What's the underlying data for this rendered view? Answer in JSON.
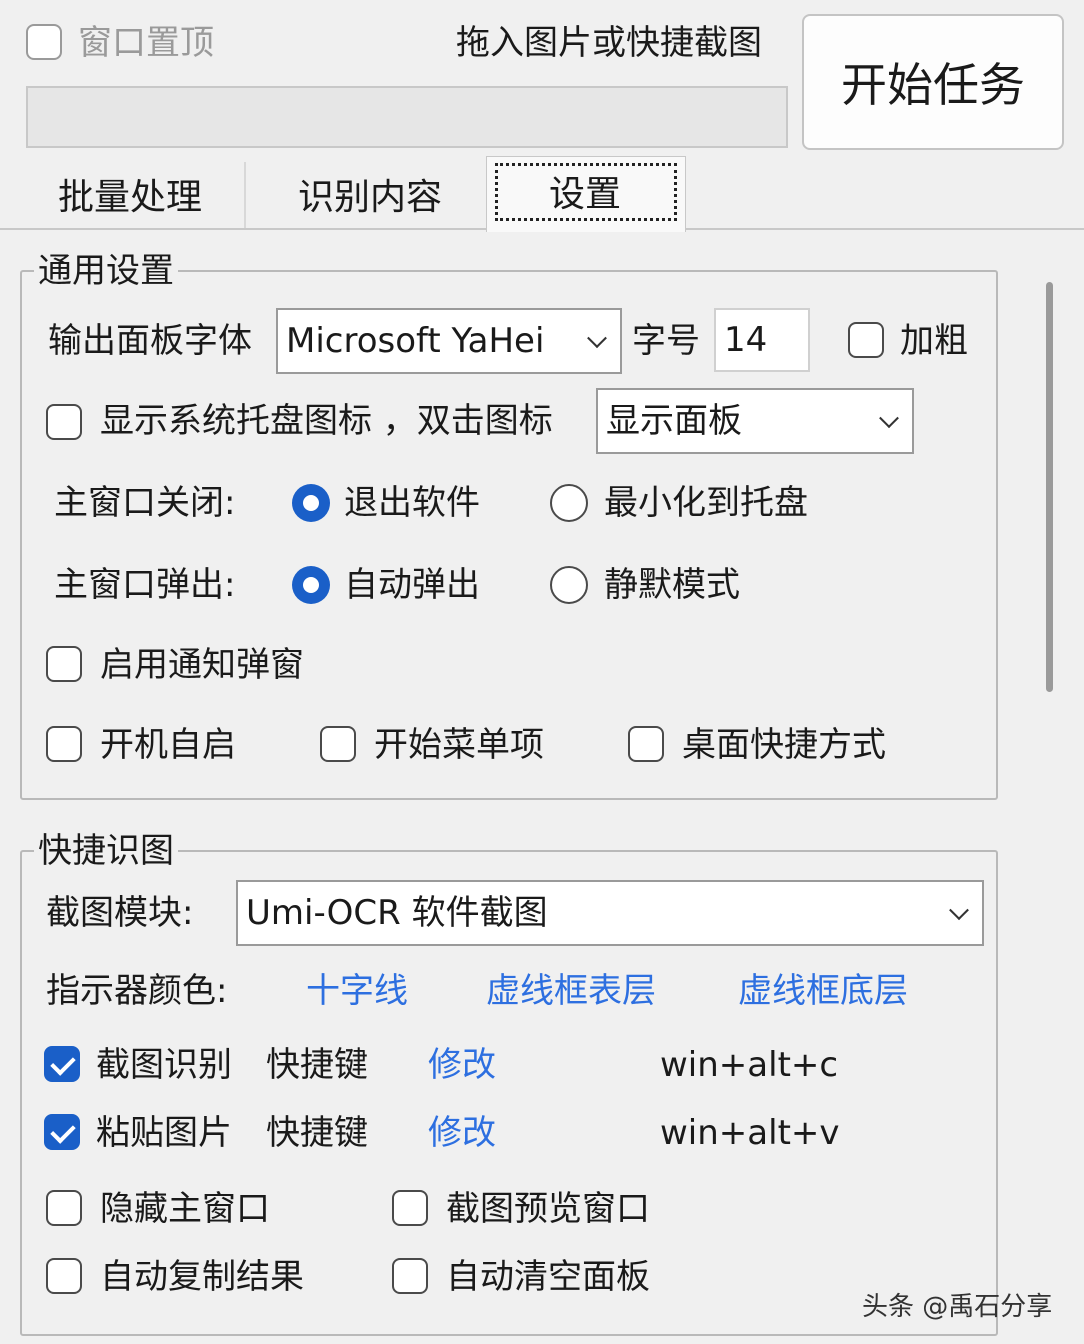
{
  "topbar": {
    "pin_label": "窗口置顶",
    "drop_hint": "拖入图片或快捷截图",
    "start_button": "开始任务"
  },
  "tabs": [
    {
      "label": "批量处理"
    },
    {
      "label": "识别内容"
    },
    {
      "label": "设置",
      "active": true
    }
  ],
  "general": {
    "title": "通用设置",
    "font_label": "输出面板字体",
    "font_value": "Microsoft YaHei",
    "size_label": "字号",
    "size_value": "14",
    "bold_label": "加粗",
    "tray_label": "显示系统托盘图标 ，双击图标",
    "tray_action_value": "显示面板",
    "close_label": "主窗口关闭:",
    "close_opt1": "退出软件",
    "close_opt2": "最小化到托盘",
    "popup_label": "主窗口弹出:",
    "popup_opt1": "自动弹出",
    "popup_opt2": "静默模式",
    "notify_label": "启用通知弹窗",
    "autostart_label": "开机自启",
    "startmenu_label": "开始菜单项",
    "desktop_label": "桌面快捷方式"
  },
  "quick": {
    "title": "快捷识图",
    "module_label": "截图模块:",
    "module_value": "Umi-OCR 软件截图",
    "indicator_label": "指示器颜色:",
    "indicator_opt1": "十字线",
    "indicator_opt2": "虚线框表层",
    "indicator_opt3": "虚线框底层",
    "row1_label": "截图识别",
    "row1_hotkey": "快捷键",
    "row1_edit": "修改",
    "row1_value": "win+alt+c",
    "row2_label": "粘贴图片",
    "row2_hotkey": "快捷键",
    "row2_edit": "修改",
    "row2_value": "win+alt+v",
    "hide_main_label": "隐藏主窗口",
    "preview_label": "截图预览窗口",
    "autocopy_label": "自动复制结果",
    "autoclear_label": "自动清空面板"
  },
  "watermark": "头条 @禹石分享",
  "colors": {
    "accent": "#1a5fc8",
    "link": "#2d6fe0",
    "background": "#f0f0f0"
  }
}
